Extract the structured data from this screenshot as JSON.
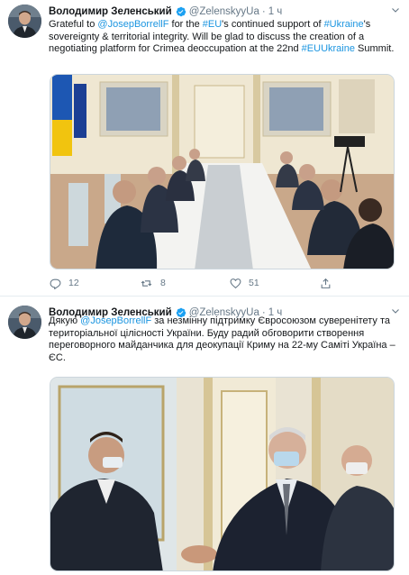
{
  "tweets": [
    {
      "author_name": "Володимир Зеленський",
      "handle": "@ZelenskyyUa",
      "separator": "·",
      "time": "1 ч",
      "text_parts": [
        {
          "t": "Grateful to ",
          "link": false
        },
        {
          "t": "@JosepBorrellF",
          "link": true
        },
        {
          "t": " for the ",
          "link": false
        },
        {
          "t": "#EU",
          "link": true
        },
        {
          "t": "'s continued support of ",
          "link": false
        },
        {
          "t": "#Ukraine",
          "link": true
        },
        {
          "t": "'s sovereignty & territorial integrity. Will be glad to discuss the creation of a negotiating platform for Crimea deoccupation at the 22nd ",
          "link": false
        },
        {
          "t": "#EUUkraine",
          "link": true
        },
        {
          "t": " Summit.",
          "link": false
        }
      ],
      "actions": {
        "replies": "12",
        "retweets": "8",
        "likes": "51"
      }
    },
    {
      "author_name": "Володимир Зеленський",
      "handle": "@ZelenskyyUa",
      "separator": "·",
      "time": "1 ч",
      "text_parts": [
        {
          "t": "Дякую ",
          "link": false
        },
        {
          "t": "@JosepBorrellF",
          "link": true
        },
        {
          "t": " за незмінну підтримку Євросоюзом суверенітету та територіальної цілісності України. Буду радий обговорити створення переговорного майданчика для деокупації Криму на 22-му Саміті Україна – ЄС.",
          "link": false
        }
      ]
    }
  ],
  "icons": {
    "verified": "verified-badge-icon",
    "caret": "chevron-down-icon",
    "reply": "reply-icon",
    "retweet": "retweet-icon",
    "like": "heart-icon",
    "share": "share-icon"
  },
  "colors": {
    "link": "#1b95e0",
    "verified": "#1da1f2",
    "muted": "#657786"
  }
}
